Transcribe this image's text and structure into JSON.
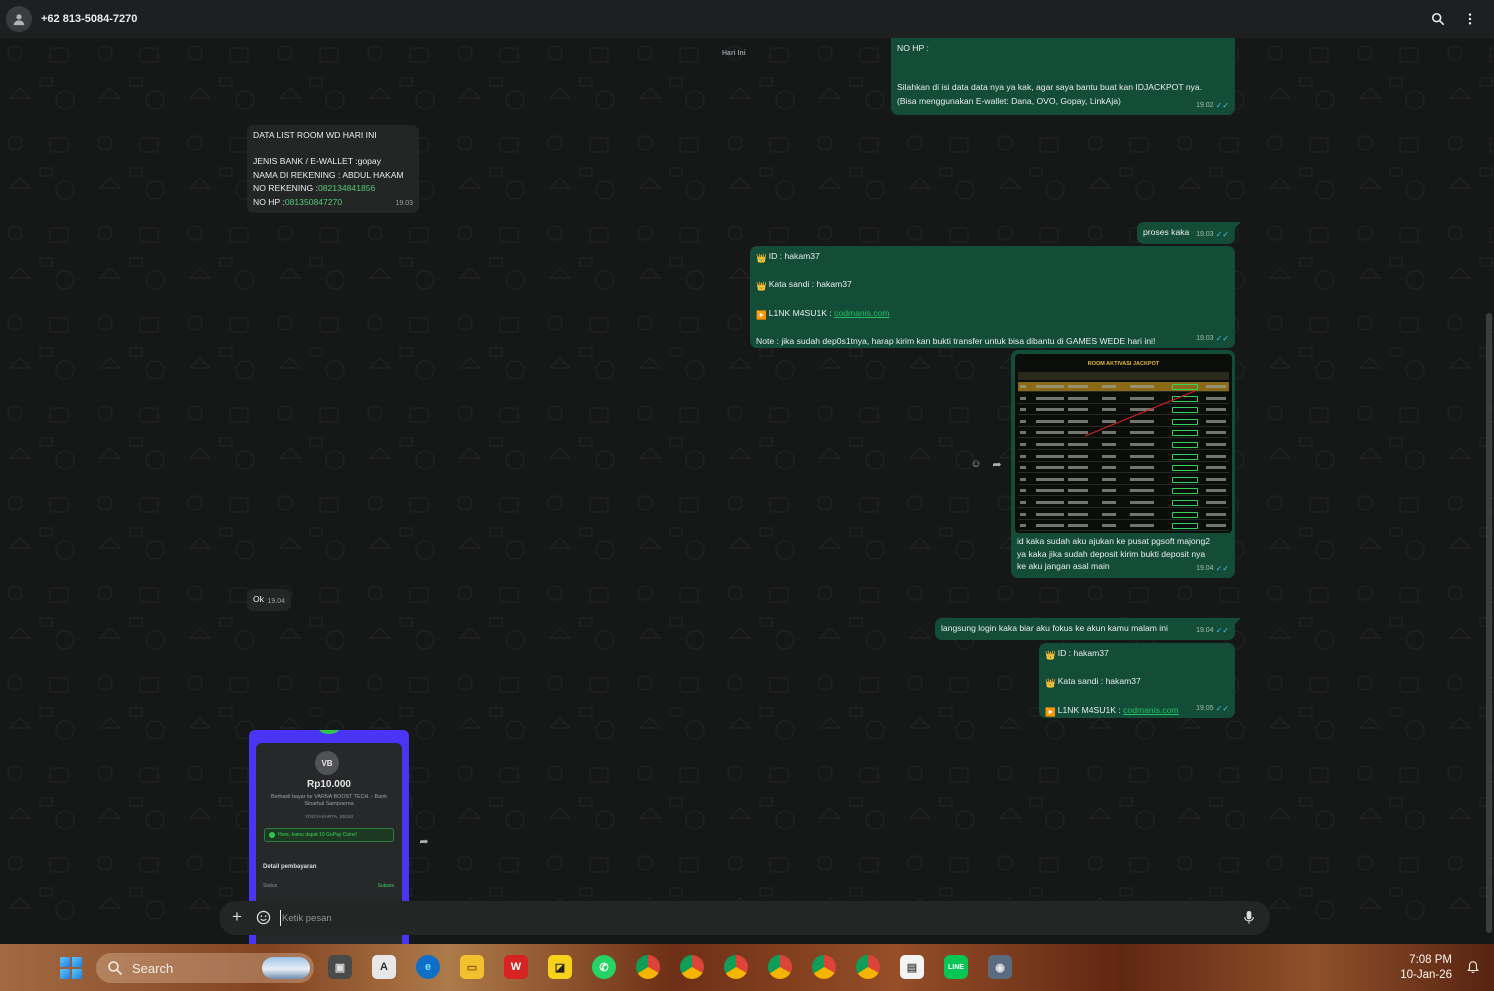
{
  "header": {
    "contact": "+62 813-5084-7270",
    "icons": [
      "person-icon",
      "search-icon",
      "more-vertical-icon"
    ]
  },
  "chat": {
    "date_chip": "Hari Ini",
    "msg1": {
      "lines": [
        "NO HP :",
        "",
        "Silahkan di isi data data nya ya kak, agar saya bantu buat kan IDJACKPOT nya.",
        "(Bisa menggunakan E-wallet: Dana, OVO, Gopay, LinkAja)"
      ],
      "time": "19.02"
    },
    "msg2": {
      "title": "DATA LIST ROOM WD HARI INI",
      "bank_label": "JENIS BANK / E-WALLET :",
      "bank_value": "gopay",
      "name_label": "NAMA DI REKENING : ",
      "name_value": "ABDUL HAKAM",
      "rek_label": "NO REKENING :",
      "rek_value": "082134841856",
      "hp_label": "NO HP :",
      "hp_value": "081350847270",
      "time": "19.03"
    },
    "msg3": {
      "text": "proses kaka",
      "time": "19.03"
    },
    "msg4": {
      "id_label": "ID :  hakam37",
      "pass_label": "Kata sandi : hakam37",
      "link_label": "L1NK M4SU1K : ",
      "link_value": "codmanis.com",
      "note": "Note : jika sudah dep0s1tnya, harap kirim kan bukti transfer untuk bisa dibantu di GAMES WEDE hari ini!",
      "time": "19.03"
    },
    "msg5": {
      "image_title": "ROOM AKTIVASI JACKPOT",
      "caption_lines": [
        "id kaka sudah aku ajukan ke pusat pgsoft majong2",
        "ya kaka jika sudah deposit kirim bukti deposit nya",
        "ke aku jangan asal main"
      ],
      "time": "19.04"
    },
    "msg6": {
      "text": "Ok",
      "time": "19.04"
    },
    "msg7": {
      "text": "langsung login kaka biar aku fokus ke akun kamu malam ini",
      "time": "19.04"
    },
    "msg8": {
      "id_label": "ID :  hakam37",
      "pass_label": "Kata sandi : hakam37",
      "link_label": "L1NK M4SU1K : ",
      "link_value": "codmanis.com",
      "time": "19.05"
    },
    "msg9": {
      "avatar_initials": "VB",
      "amount": "Rp10.000",
      "desc": "Berhasil bayar ke VARNA BOOST TECH. - Bank Sinarbal Sampoerna",
      "location": "YOGYAKARTA, 55240",
      "promo": "Hore, kamu dapat 10 GoPay Coins!",
      "detail_label": "Detail pembayaran",
      "status_label": "Status",
      "status_value": "Sukses"
    }
  },
  "composer": {
    "placeholder": "Ketik pesan"
  },
  "taskbar": {
    "search_label": "Search",
    "time": "7:08 PM",
    "date": "10-Jan-26"
  }
}
